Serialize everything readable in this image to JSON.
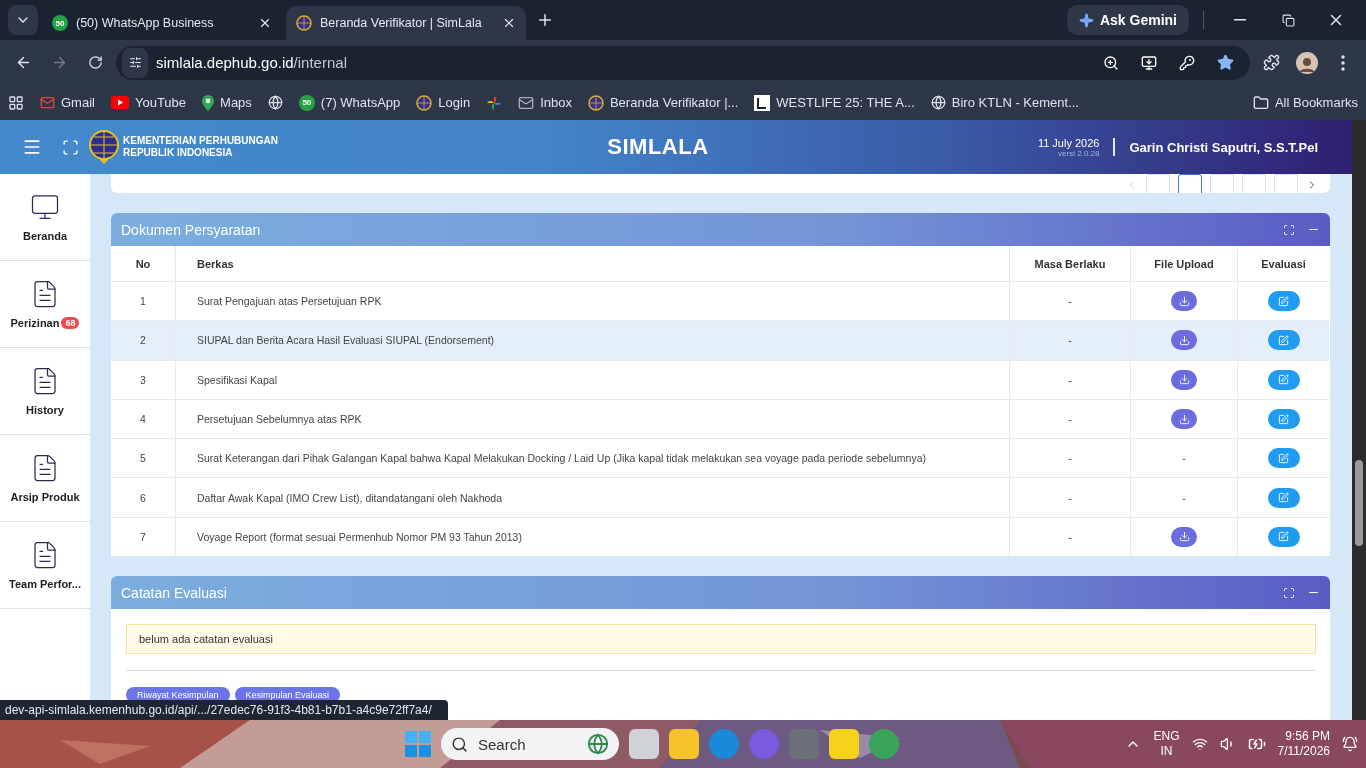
{
  "browser": {
    "tabs": [
      {
        "title": "(50) WhatsApp Business",
        "badge": "50",
        "selected": false
      },
      {
        "title": "Beranda Verifikator | SimLala",
        "selected": true
      }
    ],
    "ask_gemini": "Ask Gemini",
    "address": {
      "host": "simlala.dephub.go.id",
      "path": "/internal"
    },
    "bookmarks": [
      {
        "label": "Gmail",
        "kind": "gmail"
      },
      {
        "label": "YouTube",
        "kind": "youtube"
      },
      {
        "label": "Maps",
        "kind": "maps"
      },
      {
        "kind": "globe"
      },
      {
        "label": "(7) WhatsApp",
        "kind": "whatsapp",
        "badge": "50"
      },
      {
        "label": "Login",
        "kind": "emblem"
      },
      {
        "kind": "pinwheel"
      },
      {
        "label": "Inbox",
        "kind": "mail"
      },
      {
        "label": "Beranda Verifikator |...",
        "kind": "emblem"
      },
      {
        "label": "WESTLIFE 25: THE A...",
        "kind": "square"
      },
      {
        "label": "Biro KTLN - Kement...",
        "kind": "globe"
      }
    ],
    "all_bookmarks": "All Bookmarks"
  },
  "header": {
    "org_line_1": "KEMENTERIAN PERHUBUNGAN",
    "org_line_2": "REPUBLIK INDONESIA",
    "title": "SIMLALA",
    "date": "11 July 2026",
    "version": "versi 2.0.28",
    "user": "Garin Christi Saputri, S.S.T.Pel"
  },
  "sidebar": {
    "items": [
      {
        "label": "Beranda"
      },
      {
        "label": "Perizinan",
        "badge": "68"
      },
      {
        "label": "History"
      },
      {
        "label": "Arsip Produk"
      },
      {
        "label": "Team Perfor..."
      }
    ]
  },
  "pager": [
    {
      "selected": false
    },
    {
      "selected": true
    },
    {
      "selected": false
    },
    {
      "selected": false
    },
    {
      "selected": false
    }
  ],
  "documents": {
    "title": "Dokumen Persyaratan",
    "columns": [
      "No",
      "Berkas",
      "Masa Berlaku",
      "File Upload",
      "Evaluasi"
    ],
    "rows": [
      {
        "no": "1",
        "berkas": "Surat Pengajuan atas Persetujuan RPK",
        "masa": "-",
        "file_upload": {
          "kind": "download"
        },
        "highlighted": false
      },
      {
        "no": "2",
        "berkas": "SIUPAL dan Berita Acara Hasil Evaluasi SIUPAL (Endorsement)",
        "masa": "-",
        "file_upload": {
          "kind": "download"
        },
        "highlighted": true
      },
      {
        "no": "3",
        "berkas": "Spesifikasi Kapal",
        "masa": "-",
        "file_upload": {
          "kind": "download"
        },
        "highlighted": false
      },
      {
        "no": "4",
        "berkas": "Persetujuan Sebelumnya atas RPK",
        "masa": "-",
        "file_upload": {
          "kind": "download"
        },
        "highlighted": false
      },
      {
        "no": "5",
        "berkas": "Surat Keterangan dari Pihak Galangan Kapal bahwa Kapal Melakukan Docking / Laid Up (Jika kapal tidak melakukan sea voyage pada periode sebelumnya)",
        "masa": "-",
        "file_upload": {
          "kind": "text",
          "text": "-"
        },
        "highlighted": false
      },
      {
        "no": "6",
        "berkas": "Daftar Awak Kapal (IMO Crew List), ditandatangani oleh Nakhoda",
        "masa": "-",
        "file_upload": {
          "kind": "text",
          "text": "-"
        },
        "highlighted": false
      },
      {
        "no": "7",
        "berkas": "Voyage Report (format sesuai Permenhub Nomor PM 93 Tahun 2013)",
        "masa": "-",
        "file_upload": {
          "kind": "download"
        },
        "highlighted": false
      }
    ]
  },
  "notes": {
    "title": "Catatan Evaluasi",
    "note": "belum ada catatan evaluasi",
    "buttons": [
      "Riwayat Kesimpulan",
      "Kesimpulan Evaluasi"
    ]
  },
  "status_url": "dev-api-simlala.kemenhub.go.id/api/.../27edec76-91f3-4b81-b7b1-a4c9e72ff7a4/",
  "taskbar": {
    "search": "Search",
    "lang_1": "ENG",
    "lang_2": "IN",
    "time": "9:56 PM",
    "date": "7/11/2026"
  }
}
